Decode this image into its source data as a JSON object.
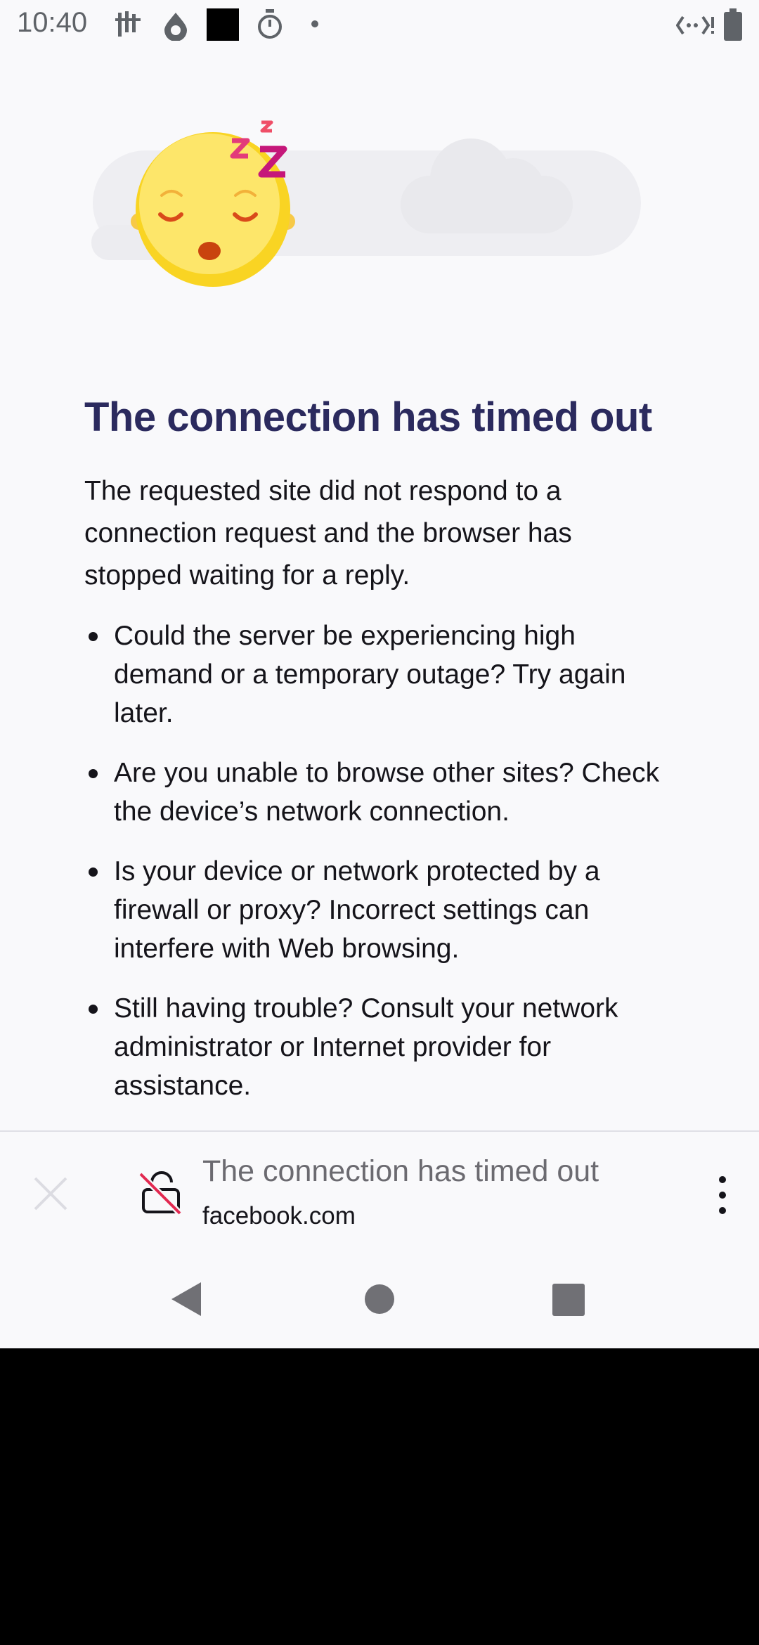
{
  "status_bar": {
    "time": "10:40"
  },
  "error_page": {
    "title": "The connection has timed out",
    "intro": "The requested site did not respond to a connection request and the browser has stopped waiting for a reply.",
    "bullets": [
      "Could the server be experiencing high demand or a temporary outage? Try again later.",
      "Are you unable to browse other sites? Check the device’s network connection.",
      "Is your device or network protected by a firewall or proxy? Incorrect settings can interfere with Web browsing.",
      "Still having trouble? Consult your network administrator or Internet provider for assistance."
    ]
  },
  "toolbar": {
    "page_title": "The connection has timed out",
    "url": "facebook.com"
  },
  "colors": {
    "title": "#2b2a5e",
    "text": "#15141a",
    "background": "#f9f9fb",
    "zzz": "#c5177a"
  },
  "icons": {
    "status": [
      "signal-bars-icon",
      "droplet-icon",
      "black-square-icon",
      "timer-icon",
      "dot-icon",
      "data-transfer-icon",
      "battery-icon"
    ],
    "toolbar": [
      "close-icon",
      "insecure-lock-icon",
      "more-vert-icon"
    ],
    "nav": [
      "back-icon",
      "home-icon",
      "recents-icon"
    ]
  }
}
